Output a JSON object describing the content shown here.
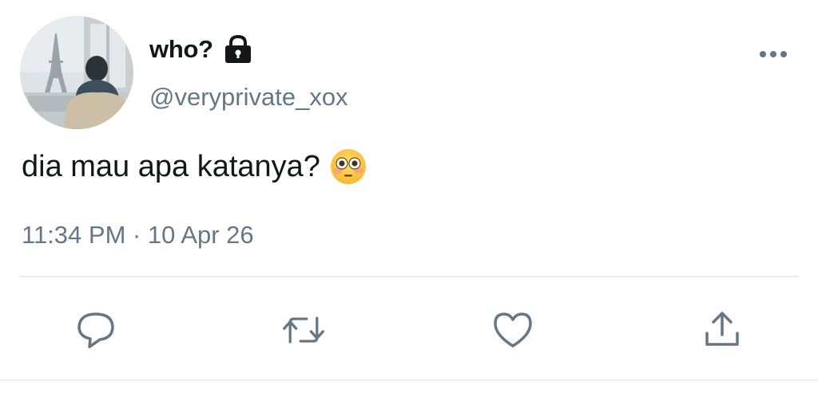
{
  "user": {
    "display_name": "who?",
    "handle": "@veryprivate_xox",
    "protected": true
  },
  "tweet": {
    "text": "dia mau apa katanya?",
    "emoji": "flushed-face",
    "timestamp": "11:34 PM · 10 Apr 26"
  },
  "actions": [
    "reply",
    "retweet",
    "like",
    "share"
  ],
  "icons": {
    "lock": "lock-icon",
    "more": "more-horizontal-icon",
    "reply": "reply-icon",
    "retweet": "retweet-icon",
    "like": "heart-icon",
    "share": "share-icon"
  },
  "colors": {
    "text": "#14171a",
    "secondary": "#657786",
    "divider": "#e6ecf0"
  }
}
